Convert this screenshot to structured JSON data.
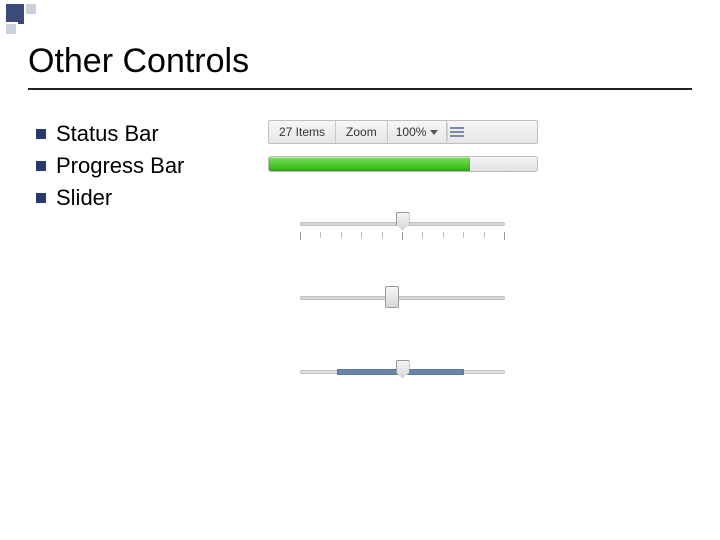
{
  "title": "Other Controls",
  "bullets": [
    "Status Bar",
    "Progress Bar",
    "Slider"
  ],
  "statusbar": {
    "items_label": "27 Items",
    "zoom_label": "Zoom",
    "zoom_value": "100%"
  },
  "progress": {
    "percent": 75
  },
  "sliders": {
    "s1_percent": 50,
    "s2_percent": 45,
    "s3_percent": 50,
    "s3_fill_start": 18,
    "s3_fill_end": 80
  }
}
